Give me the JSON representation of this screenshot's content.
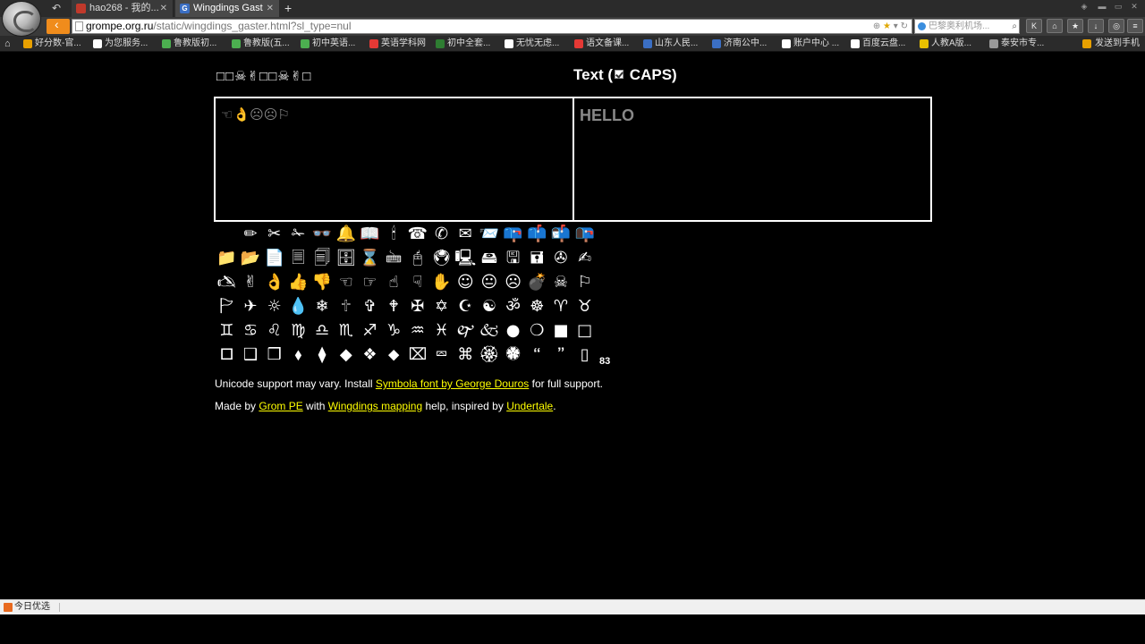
{
  "browser": {
    "tabs": [
      {
        "title": "hao268 - 我的..."
      },
      {
        "title": "Wingdings Gast",
        "favicon_letter": "G"
      }
    ],
    "address": {
      "host": "grompe.org.ru",
      "path": "/static/wingdings_gaster.html?sl_type=nul"
    },
    "search_placeholder": "巴黎奥利机场...",
    "bookmarks": [
      {
        "label": "好分数-官...",
        "color": "#e8a000"
      },
      {
        "label": "为您服务...",
        "color": "#ffffff"
      },
      {
        "label": "鲁教版初...",
        "color": "#4caf50"
      },
      {
        "label": "鲁教版(五...",
        "color": "#4caf50"
      },
      {
        "label": "初中英语...",
        "color": "#4caf50"
      },
      {
        "label": "英语学科网",
        "color": "#e53935"
      },
      {
        "label": "初中全套...",
        "color": "#2e7d32"
      },
      {
        "label": "无忧无虑...",
        "color": "#ffffff"
      },
      {
        "label": "语文备课...",
        "color": "#e53935"
      },
      {
        "label": "山东人民...",
        "color": "#3b6fc4"
      },
      {
        "label": "济南公中...",
        "color": "#3b6fc4"
      },
      {
        "label": "账户中心 ...",
        "color": "#ffffff"
      },
      {
        "label": "百度云盘...",
        "color": "#ffffff"
      },
      {
        "label": "人教A版...",
        "color": "#e8c000"
      },
      {
        "label": "泰安市专...",
        "color": "#999999"
      }
    ],
    "send_to_phone": "发送到手机"
  },
  "page": {
    "left_title": "□□☠✌□□☠✌□",
    "right_title_pre": "Text (",
    "right_title_post": " CAPS)",
    "caps_checked": true,
    "wingdings_output": "☜👌☹☹⚐",
    "text_input_value": "HELLO",
    "glyph_rows": [
      [
        " ",
        "✏",
        "✂",
        "✁",
        "👓",
        "🔔",
        "📖",
        "🕯",
        "☎",
        "✆",
        "✉",
        "📨",
        "📪",
        "📫",
        "📬",
        "📭"
      ],
      [
        "📁",
        "📂",
        "📄",
        "🗏",
        "🗐",
        "🗄",
        "⌛",
        "🖮",
        "🖰",
        "🖲",
        "🖳",
        "🖴",
        "🖫",
        "🖬",
        "✇",
        "✍"
      ],
      [
        "🖎",
        "✌",
        "👌",
        "👍",
        "👎",
        "☜",
        "☞",
        "☝",
        "☟",
        "✋",
        "☺",
        "😐",
        "☹",
        "💣",
        "☠",
        "⚐"
      ],
      [
        "🏱",
        "✈",
        "☼",
        "💧",
        "❄",
        "🕆",
        "✞",
        "🕈",
        "✠",
        "✡",
        "☪",
        "☯",
        "ॐ",
        "☸",
        "♈",
        "♉"
      ],
      [
        "♊",
        "♋",
        "♌",
        "♍",
        "♎",
        "♏",
        "♐",
        "♑",
        "♒",
        "♓",
        "🙰",
        "🙵",
        "●",
        "❍",
        "■",
        "□"
      ],
      [
        "🞐",
        "❑",
        "❒",
        "⬧",
        "⧫",
        "◆",
        "❖",
        "⬥",
        "⌧",
        "⮹",
        "⌘",
        "🏵",
        "🏶",
        "🙶",
        "🙷",
        "▯"
      ]
    ],
    "glyph_count": "83",
    "info": {
      "prefix": "Unicode support may vary. Install ",
      "link": "Symbola font by George Douros",
      "suffix": " for full support."
    },
    "credits": {
      "made_by": "Made by ",
      "author_link": "Grom PE",
      "with": " with ",
      "mapping_link": "Wingdings mapping",
      "help": " help, inspired by ",
      "inspired_link": "Undertale",
      "end": "."
    }
  },
  "statusbar": {
    "item": "今日优选"
  }
}
